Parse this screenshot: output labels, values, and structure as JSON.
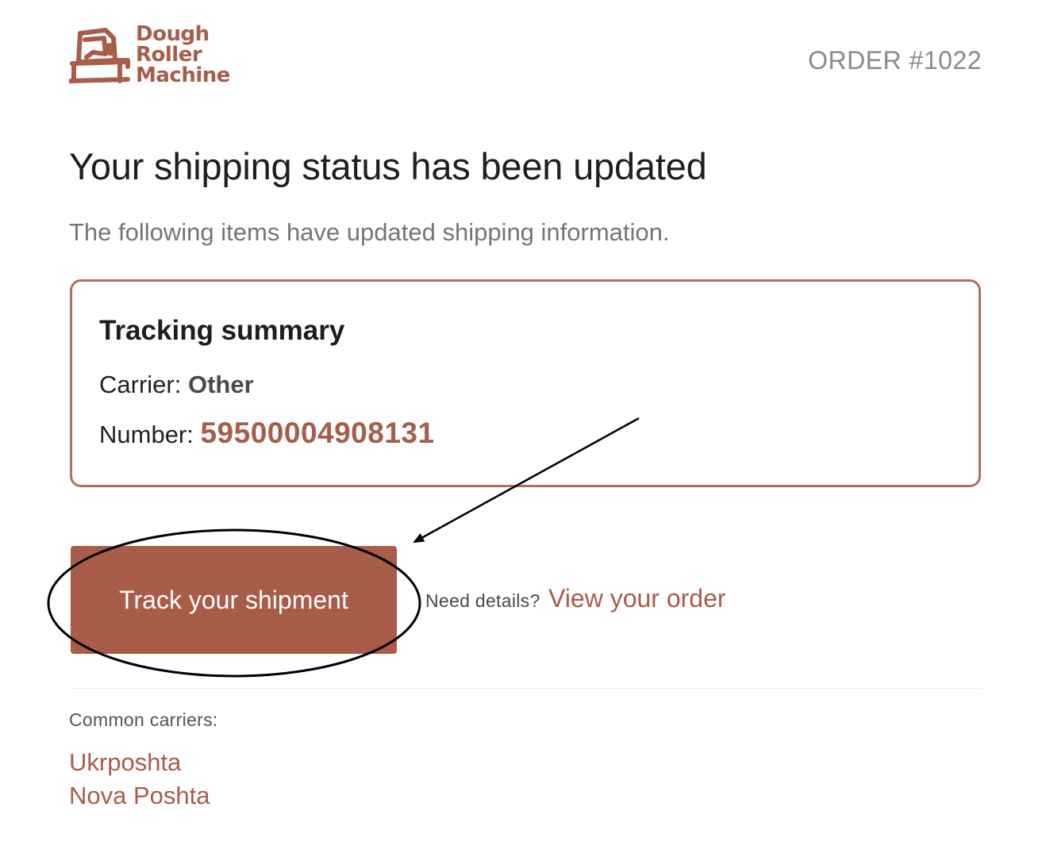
{
  "brand": {
    "name_lines": [
      "Dough",
      "Roller",
      "Machine"
    ],
    "logo_icon": "dough-roller-machine-icon",
    "color": "#a95c48"
  },
  "header": {
    "order_label": "ORDER #1022"
  },
  "main": {
    "headline": "Your shipping status has been updated",
    "subline": "The following items have updated shipping information."
  },
  "tracking": {
    "title": "Tracking summary",
    "carrier_label": "Carrier: ",
    "carrier_value": "Other",
    "number_label": "Number: ",
    "number_value": "59500004908131",
    "border_color": "#b0705d"
  },
  "actions": {
    "track_button": "Track your shipment",
    "details_label": "Need details?",
    "view_order_link": "View your order"
  },
  "carriers": {
    "label": "Common carriers:",
    "items": [
      "Ukrposhta",
      "Nova Poshta"
    ]
  },
  "annotation": {
    "ellipse_icon": "ellipse-highlight-icon",
    "arrow_icon": "arrow-pointer-icon",
    "color": "#000000"
  }
}
